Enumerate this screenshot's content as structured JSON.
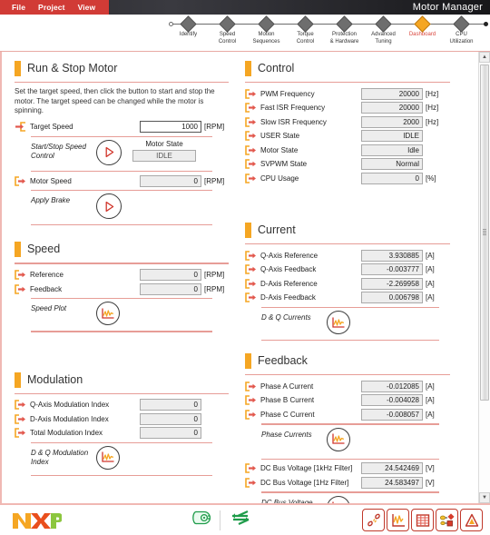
{
  "titlebar": {
    "menu": [
      {
        "label": "File"
      },
      {
        "label": "Project"
      },
      {
        "label": "View"
      }
    ],
    "app_title": "Motor Manager"
  },
  "stepbar": {
    "steps": [
      {
        "label": "Identify",
        "active": false
      },
      {
        "label": "Speed\nControl",
        "active": false
      },
      {
        "label": "Motion\nSequences",
        "active": false
      },
      {
        "label": "Torque\nControl",
        "active": false
      },
      {
        "label": "Protection\n& Hardware",
        "active": false
      },
      {
        "label": "Advanced\nTuning",
        "active": false
      },
      {
        "label": "Dashboard",
        "active": true
      },
      {
        "label": "CPU\nUtilization",
        "active": false
      }
    ],
    "active_color": "#f5a623",
    "active_text_color": "#d9453c"
  },
  "sections": {
    "run_stop": {
      "title": "Run & Stop Motor",
      "description": "Set the target speed, then click the button to start and stop the motor. The target speed can be changed while the motor is spinning.",
      "target_speed": {
        "label": "Target Speed",
        "value": "1000",
        "unit": "[RPM]",
        "icon": "input-arrow-icon",
        "editable": true
      },
      "start_stop": {
        "label": "Start/Stop Speed Control",
        "icon": "play-icon"
      },
      "motor_state": {
        "caption": "Motor State",
        "value": "IDLE"
      },
      "motor_speed": {
        "label": "Motor Speed",
        "value": "0",
        "unit": "[RPM]",
        "icon": "output-arrow-icon"
      },
      "apply_brake": {
        "label": "Apply Brake",
        "icon": "play-icon"
      }
    },
    "control": {
      "title": "Control",
      "rows": [
        {
          "label": "PWM Frequency",
          "value": "20000",
          "unit": "[Hz]",
          "icon": "output-arrow-icon"
        },
        {
          "label": "Fast ISR Frequency",
          "value": "20000",
          "unit": "[Hz]",
          "icon": "output-arrow-icon"
        },
        {
          "label": "Slow ISR Frequency",
          "value": "2000",
          "unit": "[Hz]",
          "icon": "output-arrow-icon"
        },
        {
          "label": "USER State",
          "value": "IDLE",
          "unit": "",
          "icon": "output-arrow-icon"
        },
        {
          "label": "Motor State",
          "value": "Idle",
          "unit": "",
          "icon": "output-arrow-icon"
        },
        {
          "label": "SVPWM State",
          "value": "Normal",
          "unit": "",
          "icon": "output-arrow-icon"
        },
        {
          "label": "CPU Usage",
          "value": "0",
          "unit": "[%]",
          "icon": "output-arrow-icon"
        }
      ]
    },
    "speed": {
      "title": "Speed",
      "rows": [
        {
          "label": "Reference",
          "value": "0",
          "unit": "[RPM]",
          "icon": "output-arrow-icon"
        },
        {
          "label": "Feedback",
          "value": "0",
          "unit": "[RPM]",
          "icon": "output-arrow-icon"
        }
      ],
      "plot": {
        "label": "Speed Plot",
        "icon": "plot-icon"
      }
    },
    "current": {
      "title": "Current",
      "rows": [
        {
          "label": "Q-Axis Reference",
          "value": "3.930885",
          "unit": "[A]",
          "icon": "output-arrow-icon"
        },
        {
          "label": "Q-Axis Feedback",
          "value": "-0.003777",
          "unit": "[A]",
          "icon": "output-arrow-icon"
        },
        {
          "label": "D-Axis Reference",
          "value": "-2.269958",
          "unit": "[A]",
          "icon": "output-arrow-icon"
        },
        {
          "label": "D-Axis Feedback",
          "value": "0.006798",
          "unit": "[A]",
          "icon": "output-arrow-icon"
        }
      ],
      "plot": {
        "label": "D & Q Currents",
        "icon": "plot-icon"
      }
    },
    "modulation": {
      "title": "Modulation",
      "rows": [
        {
          "label": "Q-Axis Modulation Index",
          "value": "0",
          "unit": "",
          "icon": "output-arrow-icon"
        },
        {
          "label": "D-Axis Modulation Index",
          "value": "0",
          "unit": "",
          "icon": "output-arrow-icon"
        },
        {
          "label": "Total Modulation Index",
          "value": "0",
          "unit": "",
          "icon": "output-arrow-icon"
        }
      ],
      "plot": {
        "label": "D & Q Modulation Index",
        "icon": "plot-icon"
      }
    },
    "feedback": {
      "title": "Feedback",
      "rows": [
        {
          "label": "Phase A Current",
          "value": "-0.012085",
          "unit": "[A]",
          "icon": "output-arrow-icon"
        },
        {
          "label": "Phase B Current",
          "value": "-0.004028",
          "unit": "[A]",
          "icon": "output-arrow-icon"
        },
        {
          "label": "Phase C Current",
          "value": "-0.008057",
          "unit": "[A]",
          "icon": "output-arrow-icon"
        }
      ],
      "plot": {
        "label": "Phase Currents",
        "icon": "plot-icon"
      },
      "rows2": [
        {
          "label": "DC Bus Voltage [1kHz Filter]",
          "value": "24.542469",
          "unit": "[V]",
          "icon": "output-arrow-icon"
        },
        {
          "label": "DC Bus Voltage [1Hz Filter]",
          "value": "24.583497",
          "unit": "[V]",
          "icon": "output-arrow-icon"
        }
      ],
      "plot2": {
        "label": "DC Bus Voltage",
        "icon": "plot-icon"
      }
    }
  },
  "statusbar": {
    "logo": "NXP",
    "mid_icons": [
      {
        "name": "motor-icon"
      },
      {
        "name": "connection-icon"
      }
    ],
    "right_icons": [
      {
        "name": "oscilloscope-probe-icon"
      },
      {
        "name": "waveform-icon"
      },
      {
        "name": "table-grid-icon"
      },
      {
        "name": "blocks-diagram-icon"
      },
      {
        "name": "control-page-icon"
      }
    ]
  },
  "scrollbar": {
    "up": "▲",
    "down": "▼"
  },
  "colors": {
    "accent_orange": "#f5a623",
    "accent_red": "#d9453c",
    "menu_red": "#d13b36",
    "rule_pink": "#e79d97"
  }
}
